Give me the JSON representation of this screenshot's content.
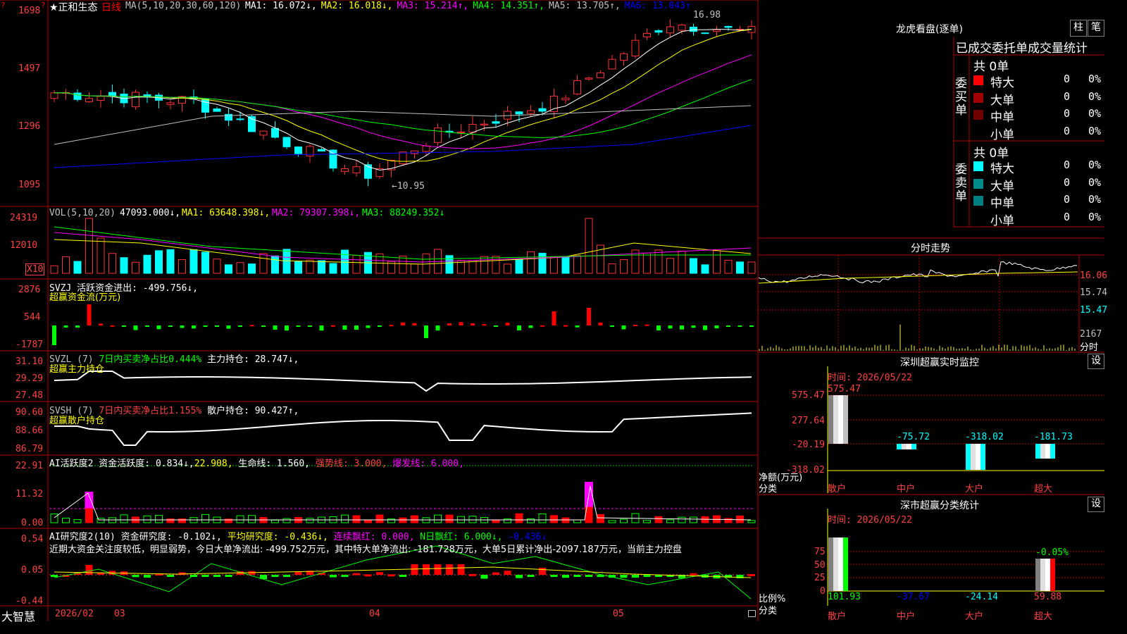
{
  "main": {
    "title": "★正和生态",
    "period": "日线",
    "ma_params": "MA(5,10,20,30,60,120)",
    "ma_list": [
      {
        "label": "MA1: 16.072↓,",
        "color": "#ffffff"
      },
      {
        "label": "MA2: 16.018↓,",
        "color": "#ffff00"
      },
      {
        "label": "MA3: 15.214↑,",
        "color": "#ff00ff"
      },
      {
        "label": "MA4: 14.351↑,",
        "color": "#00ff00"
      },
      {
        "label": "MA5: 13.705↑,",
        "color": "#c0c0c0"
      },
      {
        "label": "MA6: 13.043↑",
        "color": "#0000ff"
      }
    ],
    "y_labels": [
      "1698",
      "1497",
      "1296",
      "1095"
    ],
    "high_label": "16.98",
    "low_label": "←10.95",
    "corner_mark": "?"
  },
  "vol": {
    "header": "VOL(5,10,20)",
    "value": "47093.000↓,",
    "ma1": "MA1: 63648.398↓,",
    "ma2": "MA2: 79307.398↓,",
    "ma3": "MA3: 88249.352↓",
    "y_labels": [
      "24319",
      "12010"
    ],
    "unit": "X10"
  },
  "svzj": {
    "header": "SVZJ  活跃资金进出: -499.756↓,",
    "sub": "超赢资金流(万元)",
    "y_labels": [
      "2876",
      "544",
      "-1787"
    ]
  },
  "svzl": {
    "prefix": "SVZL (7) ",
    "ratio": "7日内买卖净占比0.444%",
    "hold": " 主力持仓: 28.747↓,",
    "sub": "超赢主力持仓",
    "y_labels": [
      "31.10",
      "29.29",
      "27.48"
    ]
  },
  "svsh": {
    "prefix": "SVSH (7) ",
    "ratio": "7日内买卖净占比1.155%",
    "hold": " 散户持仓: 90.427↑,",
    "sub": "超赢散户持仓",
    "y_labels": [
      "90.60",
      "88.66",
      "86.79"
    ]
  },
  "ai1": {
    "a": "AI活跃度2 资金活跃度: 0.834↓,",
    "b": "22.908,",
    "c": " 生命线: 1.560,",
    "d": " 强势线: 3.000,",
    "e": " 爆发线: 6.000,",
    "y_labels": [
      "22.91",
      "11.32",
      "0.00"
    ]
  },
  "ai2": {
    "a": "AI研究度2(10) 资金研究度: -0.102↓,",
    "b": " 平均研究度: -0.436↓,",
    "c": " 连续飘红: 0.000,",
    "d": " N日飘红: 6.000↓,",
    "e": " -0.436↓",
    "text": "近期大资金关注度较低，明显弱势，今日大单净流出: -499.752万元，其中特大单净流出: -181.728万元，大单5日累计净出-2097.187万元，当前主力控盘",
    "y_labels": [
      "0.54",
      "0.05",
      "-0.44"
    ]
  },
  "footer": {
    "brand": "大智慧",
    "dates": [
      "2026/02",
      "03",
      "04",
      "05"
    ]
  },
  "lhb": {
    "title": "龙虎看盘(逐单)",
    "btn1": "柱",
    "btn2": "笔",
    "tabs": "已成交委托单成交量统计",
    "buy_label": "委买单",
    "sell_label": "委卖单",
    "buy_total": "共 0单",
    "sell_total": "共 0单",
    "buy_rows": [
      {
        "name": "特大",
        "v": "0",
        "p": "0%",
        "color": "#ff0000"
      },
      {
        "name": "大单",
        "v": "0",
        "p": "0%",
        "color": "#a00000"
      },
      {
        "name": "中单",
        "v": "0",
        "p": "0%",
        "color": "#700000"
      },
      {
        "name": "小单",
        "v": "0",
        "p": "0%",
        "color": ""
      }
    ],
    "sell_rows": [
      {
        "name": "特大",
        "v": "0",
        "p": "0%",
        "color": "#00ffff"
      },
      {
        "name": "大单",
        "v": "0",
        "p": "0%",
        "color": "#008b8b"
      },
      {
        "name": "中单",
        "v": "0",
        "p": "0%",
        "color": "#008080"
      },
      {
        "name": "小单",
        "v": "0",
        "p": "0%",
        "color": ""
      }
    ]
  },
  "fenshi": {
    "title": "分时走势",
    "y_labels": [
      "16.06",
      "15.74",
      "15.47",
      "2167"
    ],
    "unit": "分时"
  },
  "sz_monitor": {
    "title": "深圳超赢实时监控",
    "btn": "设",
    "time": "时间: 2026/05/22",
    "y_labels": [
      "575.47",
      "277.64",
      "-20.19",
      "-318.02"
    ],
    "ylabel": "净额(万元)",
    "xlabel": "分类",
    "cats": [
      "散户",
      "中户",
      "大户",
      "超大"
    ],
    "values": [
      "575.47",
      "-75.72",
      "-318.02",
      "-181.73"
    ]
  },
  "sz_stats": {
    "title": "深市超赢分类统计",
    "btn": "设",
    "time": "时间: 2026/05/22",
    "y_labels": [
      "75",
      "50",
      "25",
      "0"
    ],
    "ylabel": "比例%",
    "xlabel": "分类",
    "cats": [
      "散户",
      "中户",
      "大户",
      "超大"
    ],
    "values": [
      "101.93",
      "-37.67",
      "-24.14",
      "59.88"
    ],
    "top_label": "-0.05%"
  }
}
